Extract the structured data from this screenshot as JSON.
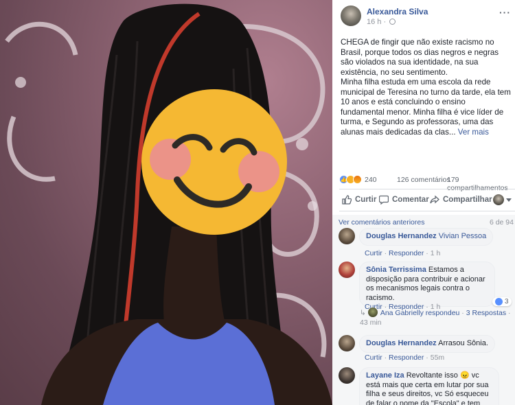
{
  "post": {
    "author": "Alexandra Silva",
    "time": "16 h",
    "text_lines": [
      "CHEGA de fingir que não existe racismo no Brasil, porque todos os dias negros e negras são violados na sua identidade, na sua existência, no seu sentimento.",
      "Minha filha estuda em uma escola da rede municipal de Teresina no turno da tarde, ela tem 10 anos e está concluindo o ensino fundamental menor. Minha filha é vice líder de turma, e Segundo as professoras, uma das alunas mais dedicadas da clas..."
    ],
    "see_more": "Ver mais",
    "reaction_count": "240",
    "comments_count": "126 comentários",
    "shares_count": "179 compartilhamentos"
  },
  "actions": {
    "like": "Curtir",
    "comment": "Comentar",
    "share": "Compartilhar"
  },
  "comments_header": {
    "previous": "Ver comentários anteriores",
    "count": "6 de 94"
  },
  "comments": [
    {
      "name": "Douglas Hernandez",
      "tag": "Vivian Pessoa",
      "text": "",
      "like": "Curtir",
      "reply": "Responder",
      "time": "1 h"
    },
    {
      "name": "Sônia Terrissima",
      "tag": "",
      "text": "Estamos a disposição para contribuir e acionar os mecanismos legais contra o racismo.",
      "like": "Curtir",
      "reply": "Responder",
      "time": "1 h",
      "reactions": "3",
      "reply_summary": {
        "who": "Ana Gabrielly respondeu",
        "replies": "3 Respostas",
        "time": "43 min"
      }
    },
    {
      "name": "Douglas Hernandez",
      "tag": "",
      "text": "Arrasou Sônia.",
      "like": "Curtir",
      "reply": "Responder",
      "time": "55m"
    },
    {
      "name": "Layane Iza",
      "tag": "",
      "text": "Revoltante isso 😠 vc está mais que certa em lutar por sua filha e seus direitos, vc Só esqueceu de falar o nome da \"Escola\" e tem mais o cabelo dela está"
    }
  ],
  "colors": {
    "link": "#385898",
    "muted": "#90949c",
    "text": "#1d2129",
    "emoji_face": "#f5b833",
    "emoji_blush": "#e98c98"
  }
}
